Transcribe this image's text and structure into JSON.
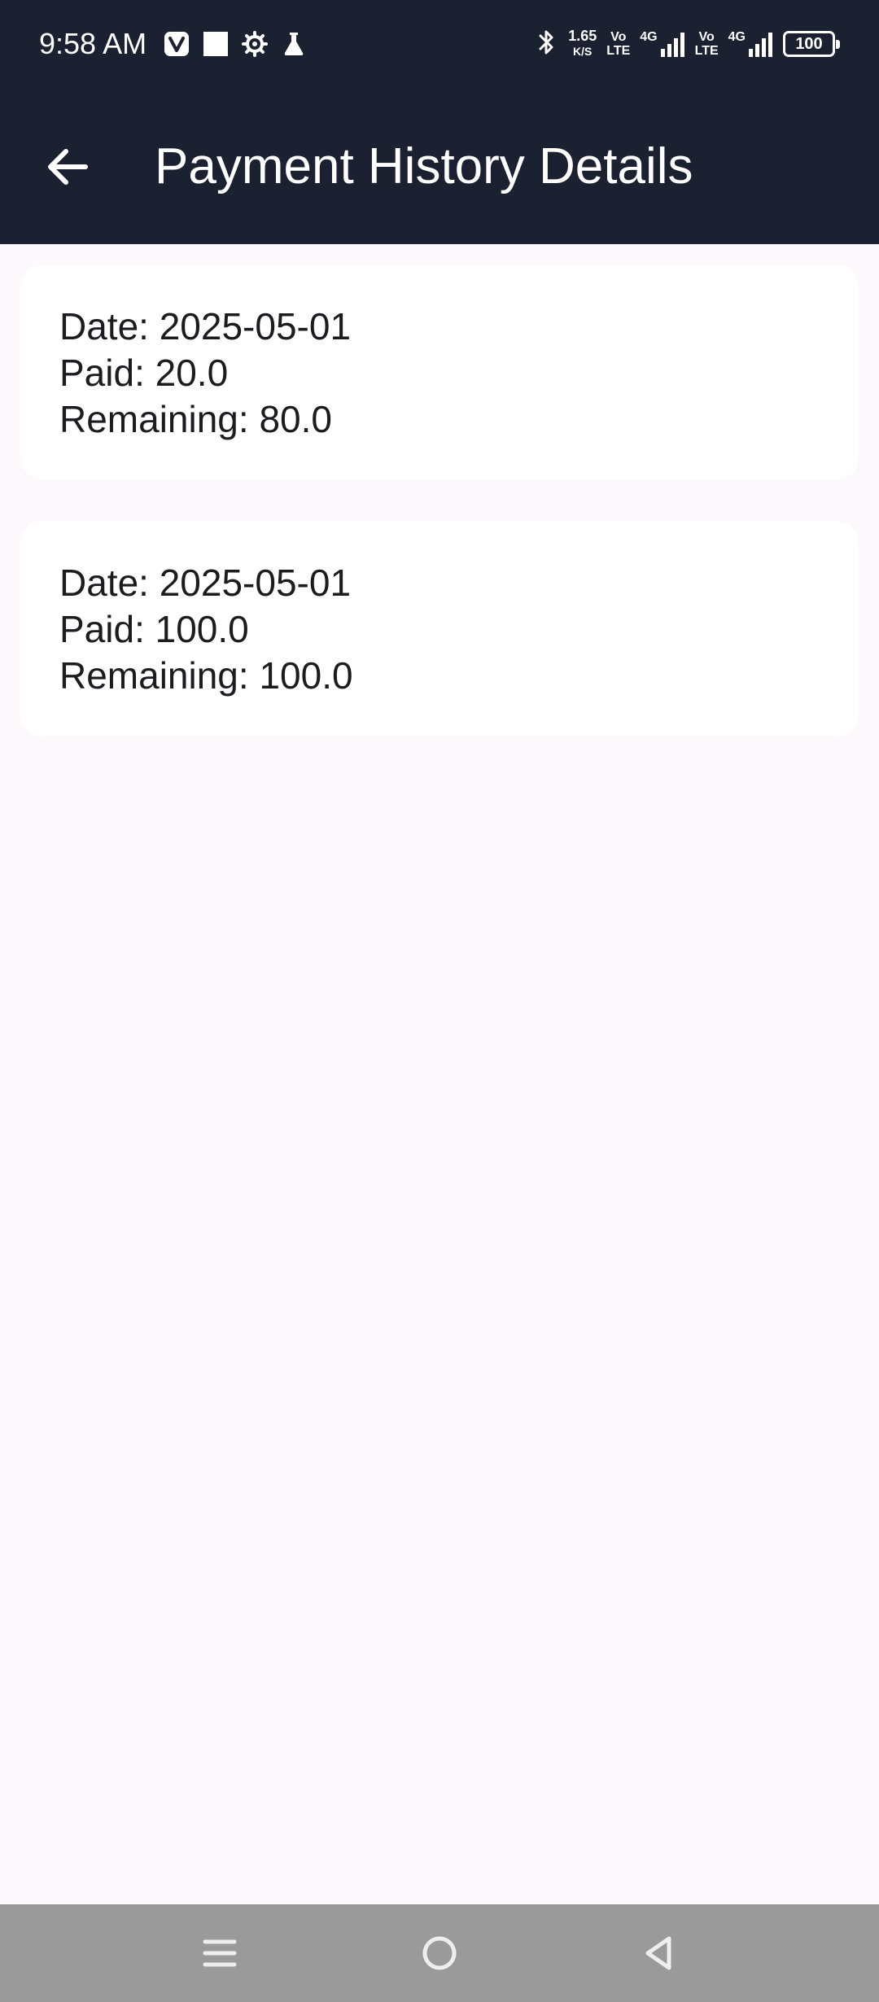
{
  "status_bar": {
    "time": "9:58 AM",
    "net_speed_value": "1.65",
    "net_speed_unit": "K/S",
    "volte1_top": "Vo",
    "volte1_bottom": "LTE",
    "sim1_label": "4G",
    "volte2_top": "Vo",
    "volte2_bottom": "LTE",
    "sim2_label": "4G",
    "battery_level": "100",
    "icons": [
      "vivaldi-icon",
      "square-notification-icon",
      "gear-icon",
      "flask-icon",
      "bluetooth-icon",
      "signal-icon",
      "battery-icon"
    ]
  },
  "app_bar": {
    "title": "Payment History Details",
    "back_icon": "arrow-left-icon",
    "background_color": "#1c2131"
  },
  "payments": [
    {
      "date": "Date: 2025-05-01",
      "paid": "Paid: 20.0",
      "remaining": "Remaining: 80.0"
    },
    {
      "date": "Date: 2025-05-01",
      "paid": "Paid: 100.0",
      "remaining": "Remaining: 100.0"
    }
  ],
  "nav_bar": {
    "icons": [
      "menu-icon",
      "home-circle-icon",
      "back-triangle-icon"
    ],
    "background_color": "#9a9a9a"
  },
  "colors": {
    "page_background": "#fdf8fc",
    "card_background": "#ffffff",
    "text": "#1d1b20"
  }
}
